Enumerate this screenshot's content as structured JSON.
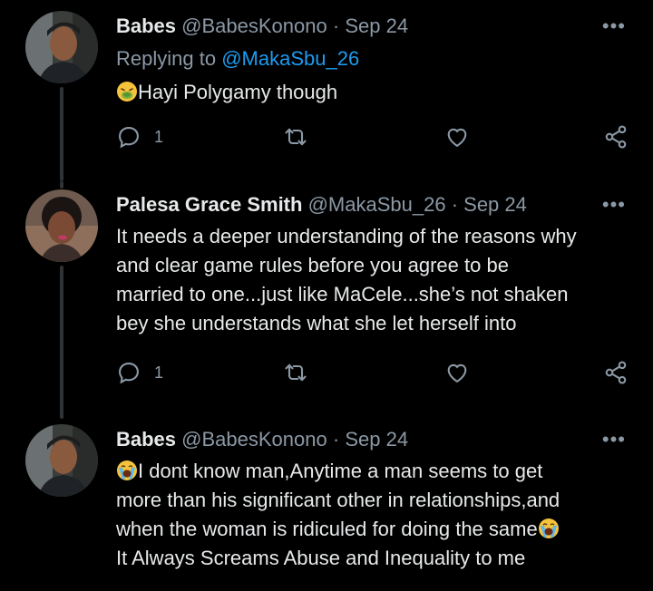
{
  "tweets": [
    {
      "name": "Babes",
      "handle": "@BabesKonono",
      "dot": "·",
      "date": "Sep 24",
      "more": "•••",
      "reply_prefix": "Replying to",
      "reply_to": "@MakaSbu_26",
      "emoji": "nauseated-face",
      "text": "Hayi Polygamy though",
      "reply_count": "1"
    },
    {
      "name": "Palesa Grace Smith",
      "handle": "@MakaSbu_26",
      "dot": "·",
      "date": "Sep 24",
      "more": "•••",
      "lines": [
        "It needs a deeper understanding of the reasons why",
        "and clear game rules before you agree to be",
        "married to one...just like MaCele...she’s not shaken",
        "bey she understands what she let herself into"
      ],
      "reply_count": "1"
    },
    {
      "name": "Babes",
      "handle": "@BabesKonono",
      "dot": "·",
      "date": "Sep 24",
      "more": "•••",
      "lines": [
        "I dont know man,Anytime a man seems to get",
        "more than his significant other in relationships,and",
        "when the woman is ridiculed for doing the same",
        "It Always Screams Abuse and Inequality to me"
      ],
      "emoji": "loudly-crying-face"
    }
  ],
  "colors": {
    "background": "#000000",
    "text": "#e7e9ea",
    "secondary": "#8b98a5",
    "link": "#1d9bf0",
    "thread_line": "#2f3336"
  }
}
